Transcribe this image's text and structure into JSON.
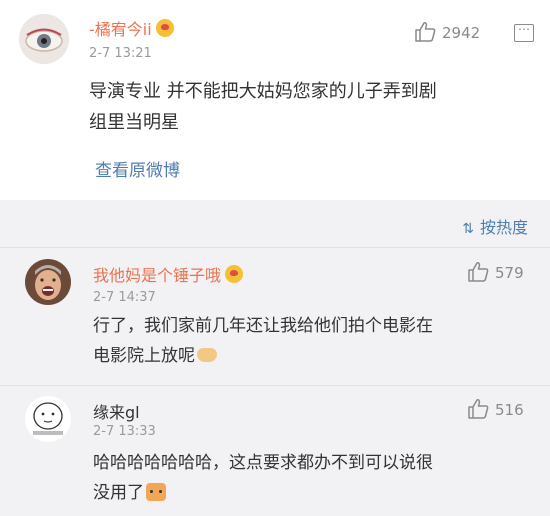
{
  "post": {
    "username": "-橘宥今ii",
    "timestamp": "2-7 13:21",
    "likes": "2942",
    "text_line1": "导演专业 并不能把大姑妈您家的儿子弄到剧",
    "text_line2": "组里当明星",
    "view_original": "查看原微博"
  },
  "sort_label": "按热度",
  "comments": [
    {
      "username": "我他妈是个锤子哦",
      "timestamp": "2-7 14:37",
      "likes": "579",
      "text_line1": "行了，我们家前几年还让我给他们拍个电影在",
      "text_line2": "电影院上放呢"
    },
    {
      "username": "缘来gl",
      "timestamp": "2-7 13:33",
      "likes": "516",
      "text_line1": "哈哈哈哈哈哈哈，这点要求都办不到可以说很",
      "text_line2": "没用了"
    }
  ],
  "colors": {
    "username": "#eb7350",
    "link": "#507daf",
    "comments_bg": "#f2f2f5"
  },
  "icons": {
    "like": "thumbs-up-icon",
    "report": "report-icon",
    "sort": "sort-icon"
  }
}
